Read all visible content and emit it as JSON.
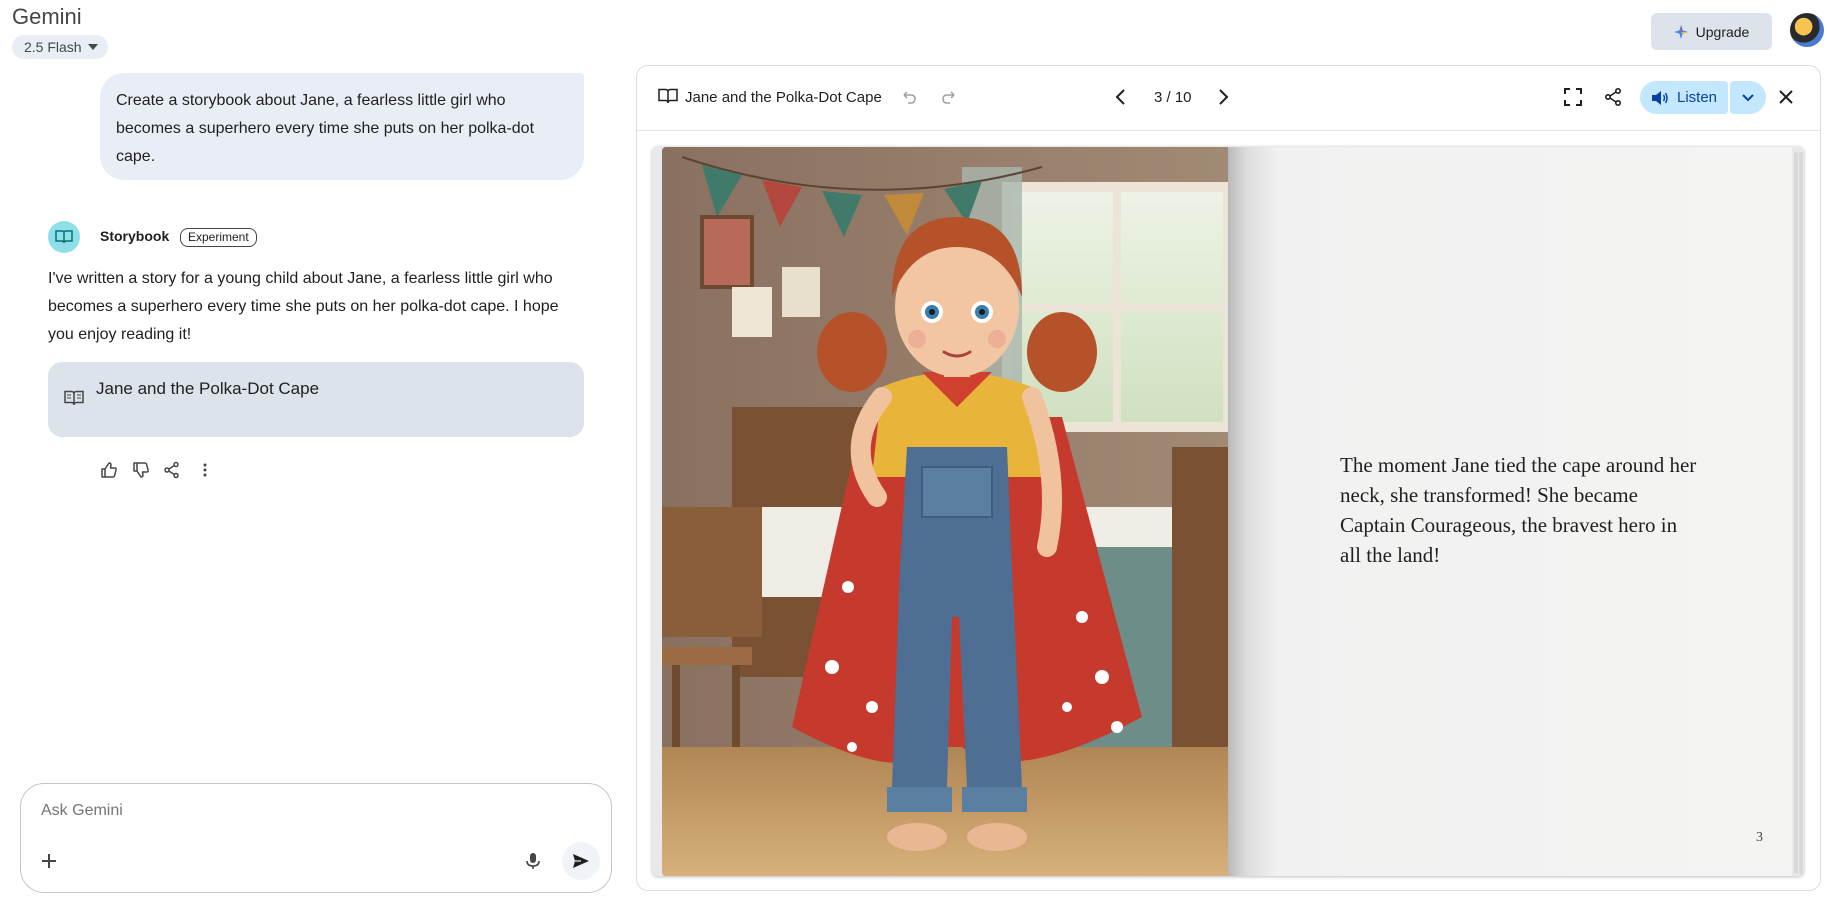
{
  "header": {
    "app_title": "Gemini",
    "model_selector": "2.5 Flash",
    "upgrade_label": "Upgrade"
  },
  "chat": {
    "user_message": "Create a storybook about Jane, a fearless little girl who becomes a superhero every time she puts on her polka-dot cape.",
    "bot_name": "Storybook",
    "bot_badge": "Experiment",
    "bot_message": "I've written a story for a young child about Jane, a fearless little girl who becomes a superhero every time she puts on her polka-dot cape. I hope you enjoy reading it!",
    "story_card_title": "Jane and the Polka-Dot Cape",
    "actions": [
      "thumb-up-icon",
      "thumb-down-icon",
      "share-icon",
      "more-vert-icon"
    ]
  },
  "input": {
    "placeholder": "Ask Gemini"
  },
  "storybook": {
    "title": "Jane and the Polka-Dot Cape",
    "page_indicator": "3 / 10",
    "listen_label": "Listen",
    "page_text": "The moment Jane tied the cape around her neck, she transformed! She became Captain Courageous, the bravest hero in all the land!",
    "page_number": "3"
  },
  "colors": {
    "accent": "#c2e7ff",
    "accent_text": "#0842a0",
    "bubble": "#e9eef6",
    "card": "#dde3ea"
  }
}
